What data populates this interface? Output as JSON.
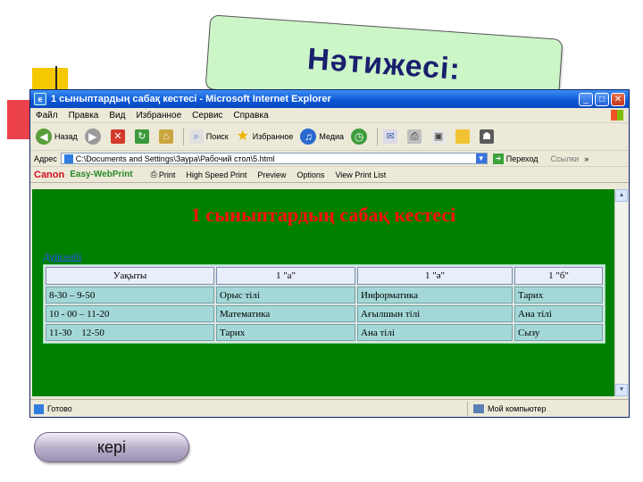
{
  "slide": {
    "heading": "Нәтижесі:",
    "back_label": "кері"
  },
  "window": {
    "title": "1 сыныптардың сабақ кестесі - Microsoft Internet Explorer",
    "menu": [
      "Файл",
      "Правка",
      "Вид",
      "Избранное",
      "Сервис",
      "Справка"
    ],
    "toolbar": {
      "back": "Назад",
      "search": "Поиск",
      "favorites": "Избранное",
      "media": "Медиа"
    },
    "address": {
      "label": "Адрес",
      "value": "C:\\Documents and Settings\\Заура\\Рабочий стол\\5.html",
      "go": "Переход",
      "links": "Ссылки"
    },
    "canon_bar": {
      "brand": "Canon",
      "product": "Easy-WebPrint",
      "print": "Print",
      "high_speed_print": "High Speed Print",
      "preview": "Preview",
      "options": "Options",
      "view_print_list": "View Print List"
    },
    "status": {
      "text": "Готово",
      "zone": "Мой компьютер"
    }
  },
  "page": {
    "heading": "1 сыныптардың сабақ кестесі",
    "day": "Дүйсенбі",
    "table": {
      "headers": [
        "Уақыты",
        "1 \"а\"",
        "1 \"ә\"",
        "1 \"б\""
      ],
      "rows": [
        [
          "8-30 – 9-50",
          "Орыс тілі",
          "Информатика",
          "Тарих"
        ],
        [
          "10 - 00 – 11-20",
          "Математика",
          "Ағылшын тілі",
          "Ана тілі"
        ],
        [
          "11-30    12-50",
          "Тарих",
          "Ана тілі",
          "Сызу"
        ]
      ]
    }
  },
  "colors": {
    "page_background": "#008000",
    "heading_red": "#ff1010",
    "title_card": "#ccf5c8"
  }
}
